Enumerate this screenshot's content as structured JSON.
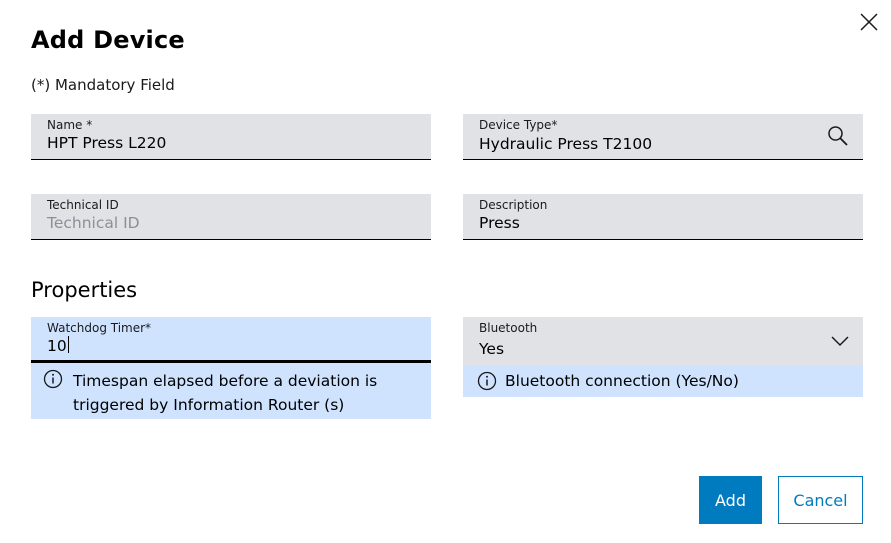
{
  "dialog": {
    "title": "Add Device",
    "mandatory_note": "(*) Mandatory Field",
    "fields": {
      "name": {
        "label": "Name *",
        "value": "HPT Press L220"
      },
      "device_type": {
        "label": "Device Type*",
        "value": "Hydraulic Press T2100"
      },
      "technical_id": {
        "label": "Technical ID",
        "placeholder": "Technical ID"
      },
      "description": {
        "label": "Description",
        "value": "Press"
      }
    },
    "properties": {
      "heading": "Properties",
      "watchdog": {
        "label": "Watchdog Timer*",
        "value": "10",
        "helper": "Timespan elapsed before a deviation is triggered by Information Router (s)"
      },
      "bluetooth": {
        "label": "Bluetooth",
        "value": "Yes",
        "helper": "Bluetooth connection (Yes/No)"
      }
    },
    "buttons": {
      "add": "Add",
      "cancel": "Cancel"
    },
    "icons": {
      "close": "close-icon",
      "search": "search-icon",
      "info": "info-icon",
      "dropdown": "chevron-down-icon"
    },
    "colors": {
      "primary": "#007bc0",
      "field_bg": "#e0e2e5",
      "focus_bg": "#cfe3ff"
    }
  }
}
